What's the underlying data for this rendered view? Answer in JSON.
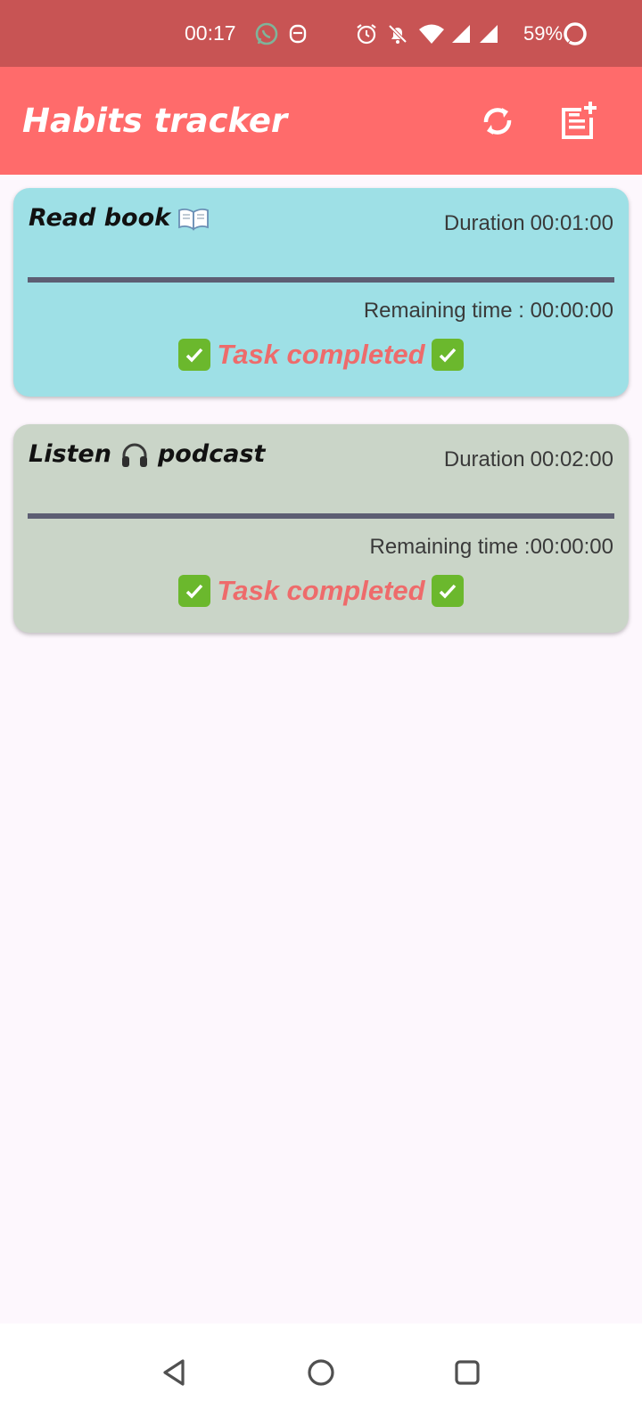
{
  "status_bar": {
    "time": "00:17",
    "battery_percent": "59%",
    "icons": [
      "whatsapp-icon",
      "notification-app-icon",
      "alarm-icon",
      "bell-off-icon",
      "wifi-icon",
      "signal-icon",
      "signal-icon",
      "battery-ring-icon"
    ]
  },
  "app_bar": {
    "title": "Habits tracker",
    "actions": [
      "refresh-icon",
      "add-note-icon"
    ],
    "background": "#ff6b6b"
  },
  "habits": [
    {
      "name": "Read book",
      "emoji": "open-book",
      "duration_label": "Duration",
      "duration": "00:01:00",
      "remaining_label": "Remaining time : ",
      "remaining": "00:00:00",
      "status": "Task completed",
      "progress": 1.0,
      "color": "#9ee0e6"
    },
    {
      "name_before": "Listen",
      "emoji": "headphones",
      "name_after": "podcast",
      "duration_label": "Duration",
      "duration": "00:02:00",
      "remaining_label": "Remaining time :",
      "remaining": "00:00:00",
      "status": "Task completed",
      "progress": 1.0,
      "color": "#cad5c8"
    }
  ],
  "nav_bar": [
    "back-icon",
    "home-icon",
    "recents-icon"
  ]
}
